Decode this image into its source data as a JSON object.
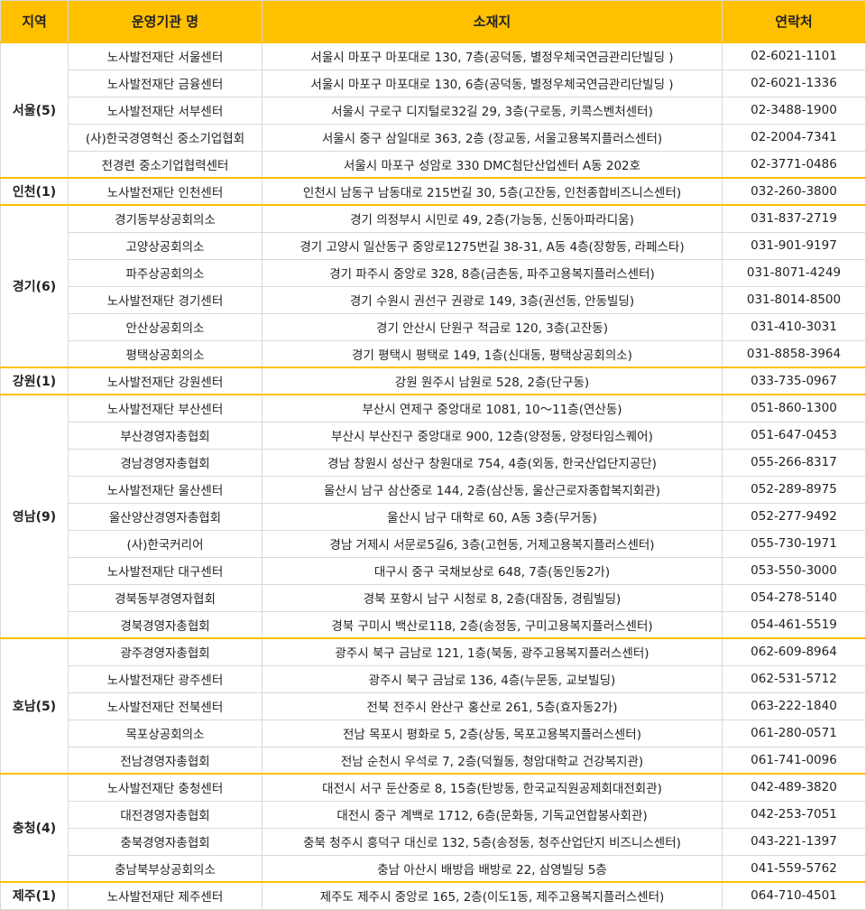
{
  "headers": {
    "region": "지역",
    "org": "운영기관 명",
    "address": "소재지",
    "contact": "연락처"
  },
  "groups": [
    {
      "region": "서울(5)",
      "rows": [
        {
          "org": "노사발전재단 서울센터",
          "address": "서울시 마포구 마포대로 130, 7층(공덕동, 별정우체국연금관리단빌딩 )",
          "contact": "02-6021-1101"
        },
        {
          "org": "노사발전재단 금융센터",
          "address": "서울시 마포구 마포대로 130, 6층(공덕동, 별정우체국연금관리단빌딩 )",
          "contact": "02-6021-1336"
        },
        {
          "org": "노사발전재단 서부센터",
          "address": "서울시 구로구 디지털로32길 29, 3층(구로동, 키콕스벤처센터)",
          "contact": "02-3488-1900"
        },
        {
          "org": "(사)한국경영혁신 중소기업협회",
          "address": "서울시 중구 삼일대로 363, 2층 (장교동, 서울고용복지플러스센터)",
          "contact": "02-2004-7341"
        },
        {
          "org": "전경련 중소기업협력센터",
          "address": "서울시 마포구 성암로 330 DMC첨단산업센터 A동 202호",
          "contact": "02-3771-0486"
        }
      ]
    },
    {
      "region": "인천(1)",
      "rows": [
        {
          "org": "노사발전재단 인천센터",
          "address": "인천시 남동구 남동대로 215번길 30, 5층(고잔동, 인천종합비즈니스센터)",
          "contact": "032-260-3800"
        }
      ]
    },
    {
      "region": "경기(6)",
      "rows": [
        {
          "org": "경기동부상공회의소",
          "address": "경기 의정부시 시민로 49, 2층(가능동, 신동아파라디움)",
          "contact": "031-837-2719"
        },
        {
          "org": "고양상공회의소",
          "address": "경기 고양시 일산동구 중앙로1275번길 38-31, A동 4층(장항동, 라페스타)",
          "contact": "031-901-9197"
        },
        {
          "org": "파주상공회의소",
          "address": "경기 파주시 중앙로 328, 8층(금촌동, 파주고용복지플러스센터)",
          "contact": "031-8071-4249"
        },
        {
          "org": "노사발전재단 경기센터",
          "address": "경기 수원시 권선구 권광로 149, 3층(권선동, 안동빌딩)",
          "contact": "031-8014-8500"
        },
        {
          "org": "안산상공회의소",
          "address": "경기 안산시 단원구 적금로 120, 3층(고잔동)",
          "contact": "031-410-3031"
        },
        {
          "org": "평택상공회의소",
          "address": "경기 평택시 평택로 149, 1층(신대동, 평택상공회의소)",
          "contact": "031-8858-3964"
        }
      ]
    },
    {
      "region": "강원(1)",
      "rows": [
        {
          "org": "노사발전재단 강원센터",
          "address": "강원 원주시 남원로 528, 2층(단구동)",
          "contact": "033-735-0967"
        }
      ]
    },
    {
      "region": "영남(9)",
      "rows": [
        {
          "org": "노사발전재단 부산센터",
          "address": "부산시 연제구 중앙대로 1081, 10～11층(연산동)",
          "contact": "051-860-1300"
        },
        {
          "org": "부산경영자총협회",
          "address": "부산시 부산진구 중앙대로 900, 12층(양정동, 양정타임스퀘어)",
          "contact": "051-647-0453"
        },
        {
          "org": "경남경영자총협회",
          "address": "경남 창원시 성산구 창원대로 754, 4층(외동, 한국산업단지공단)",
          "contact": "055-266-8317"
        },
        {
          "org": "노사발전재단 울산센터",
          "address": "울산시 남구 삼산중로 144, 2층(삼산동, 울산근로자종합복지회관)",
          "contact": "052-289-8975"
        },
        {
          "org": "울산양산경영자총협회",
          "address": "울산시 남구 대학로 60, A동 3층(무거동)",
          "contact": "052-277-9492"
        },
        {
          "org": "(사)한국커리어",
          "address": "경남 거제시 서문로5길6, 3층(고현동, 거제고용복지플러스센터)",
          "contact": "055-730-1971"
        },
        {
          "org": "노사발전재단 대구센터",
          "address": "대구시 중구 국채보상로 648, 7층(동인동2가)",
          "contact": "053-550-3000"
        },
        {
          "org": "경북동부경영자협회",
          "address": "경북 포항시 남구 시청로 8, 2층(대잠동, 경림빌딩)",
          "contact": "054-278-5140"
        },
        {
          "org": "경북경영자총협회",
          "address": "경북 구미시 백산로118, 2층(송정동, 구미고용복지플러스센터)",
          "contact": "054-461-5519"
        }
      ]
    },
    {
      "region": "호남(5)",
      "rows": [
        {
          "org": "광주경영자총협회",
          "address": "광주시 북구 금남로 121, 1층(북동, 광주고용복지플러스센터)",
          "contact": "062-609-8964"
        },
        {
          "org": "노사발전재단 광주센터",
          "address": "광주시 북구 금남로 136, 4층(누문동, 교보빌딩)",
          "contact": "062-531-5712"
        },
        {
          "org": "노사발전재단 전북센터",
          "address": "전북 전주시 완산구 홍산로 261, 5층(효자동2가)",
          "contact": "063-222-1840"
        },
        {
          "org": "목포상공회의소",
          "address": "전남 목포시 평화로 5, 2층(상동, 목포고용복지플러스센터)",
          "contact": "061-280-0571"
        },
        {
          "org": "전남경영자총협회",
          "address": "전남 순천시 우석로 7, 2층(덕월동, 청암대학교 건강복지관)",
          "contact": "061-741-0096"
        }
      ]
    },
    {
      "region": "충청(4)",
      "rows": [
        {
          "org": "노사발전재단 충청센터",
          "address": "대전시 서구 둔산중로 8, 15층(탄방동, 한국교직원공제회대전회관)",
          "contact": "042-489-3820"
        },
        {
          "org": "대전경영자총협회",
          "address": "대전시 중구 계백로 1712, 6층(문화동, 기독교연합봉사회관)",
          "contact": "042-253-7051"
        },
        {
          "org": "충북경영자총협회",
          "address": "충북 청주시 흥덕구 대신로 132, 5층(송정동, 청주산업단지 비즈니스센터)",
          "contact": "043-221-1397"
        },
        {
          "org": "충남북부상공회의소",
          "address": "충남 아산시 배방읍 배방로 22, 삼영빌딩 5층",
          "contact": "041-559-5762"
        }
      ]
    },
    {
      "region": "제주(1)",
      "rows": [
        {
          "org": "노사발전재단 제주센터",
          "address": "제주도 제주시 중앙로 165, 2층(이도1동, 제주고용복지플러스센터)",
          "contact": "064-710-4501"
        }
      ]
    }
  ]
}
